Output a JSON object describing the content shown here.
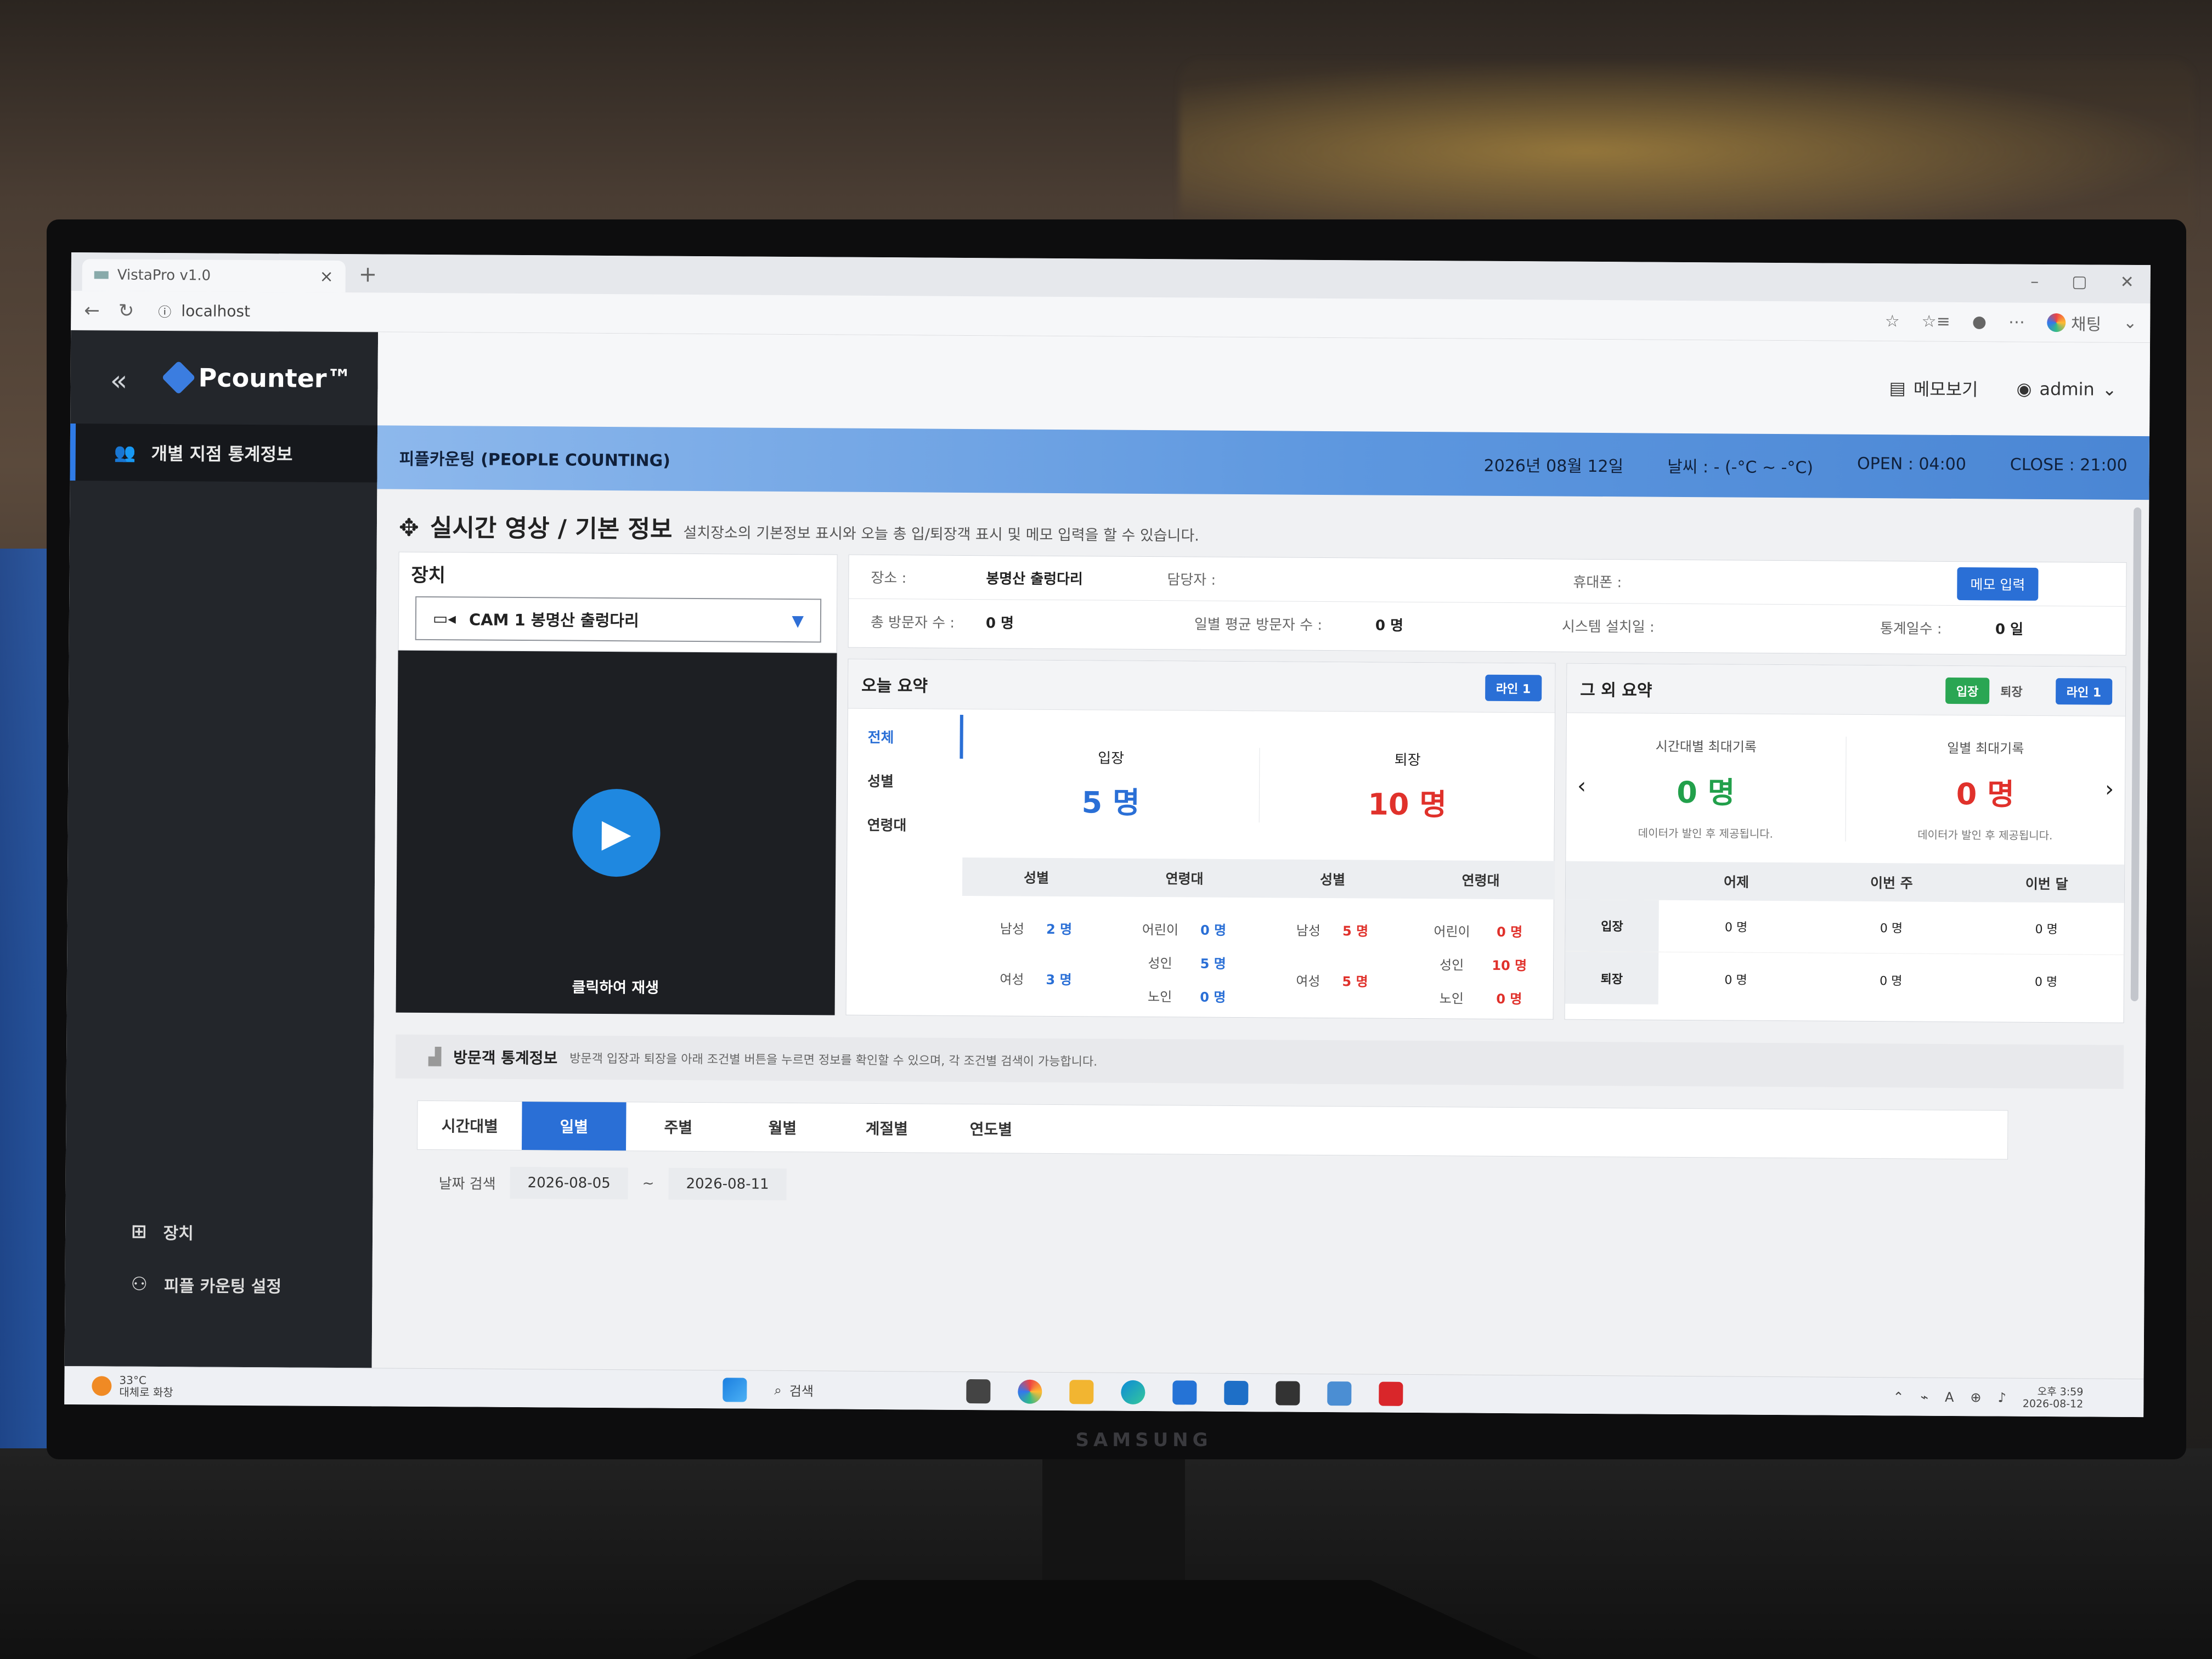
{
  "browser": {
    "tab_title": "VistaPro v1.0",
    "tab_close": "×",
    "new_tab": "+",
    "url": "localhost",
    "right_label": "채팅",
    "win_min": "–",
    "win_max": "▢",
    "win_close": "✕"
  },
  "sidebar": {
    "collapse": "«",
    "logo": "Pcounter™",
    "active_item": "개별 지점 통계정보",
    "items": [
      {
        "label": "장치"
      },
      {
        "label": "피플 카운팅 설정"
      }
    ]
  },
  "topbar": {
    "memo": "메모보기",
    "user": "admin"
  },
  "ribbon": {
    "title": "피플카운팅 (PEOPLE COUNTING)",
    "date": "2026년 08월 12일",
    "weather": "날씨 : - (-°C ~ -°C)",
    "open": "OPEN : 04:00",
    "close": "CLOSE : 21:00"
  },
  "section": {
    "title": "실시간 영상 / 기본 정보",
    "desc": "설치장소의 기본정보 표시와 오늘 총 입/퇴장객 표시 및 메모 입력을 할 수 있습니다."
  },
  "device": {
    "heading": "장치",
    "selected": "CAM 1 봉명산 출렁다리",
    "video_label": "클릭하여 재생"
  },
  "info": {
    "place_k": "장소 :",
    "place_v": "봉명산 출렁다리",
    "manager_k": "담당자 :",
    "phone_k": "휴대폰 :",
    "memo_btn": "메모 입력",
    "total_k": "총 방문자 수 :",
    "total_v": "0 명",
    "avg_k": "일별 평균 방문자 수 :",
    "avg_v": "0 명",
    "install_k": "시스템 설치일 :",
    "days_k": "통계일수 :",
    "days_v": "0 일"
  },
  "today": {
    "heading": "오늘 요약",
    "line_badge": "라인 1",
    "tabs": [
      "전체",
      "성별",
      "연령대"
    ],
    "enter_label": "입장",
    "enter_value": "5 명",
    "exit_label": "퇴장",
    "exit_value": "10 명",
    "sub_headers": [
      "성별",
      "연령대",
      "성별",
      "연령대"
    ],
    "enter_gender": [
      {
        "k": "남성",
        "v": "2 명"
      },
      {
        "k": "여성",
        "v": "3 명"
      }
    ],
    "enter_age": [
      {
        "k": "어린이",
        "v": "0 명"
      },
      {
        "k": "성인",
        "v": "5 명"
      },
      {
        "k": "노인",
        "v": "0 명"
      }
    ],
    "exit_gender": [
      {
        "k": "남성",
        "v": "5 명"
      },
      {
        "k": "여성",
        "v": "5 명"
      }
    ],
    "exit_age": [
      {
        "k": "어린이",
        "v": "0 명"
      },
      {
        "k": "성인",
        "v": "10 명"
      },
      {
        "k": "노인",
        "v": "0 명"
      }
    ]
  },
  "other": {
    "heading": "그 외 요약",
    "badge_enter": "입장",
    "badge_exit": "퇴장",
    "line_badge": "라인 1",
    "hour_max_label": "시간대별 최대기록",
    "hour_max_value": "0 명",
    "day_max_label": "일별 최대기록",
    "day_max_value": "0 명",
    "notice": "데이터가 발인 후 제공됩니다.",
    "prev": "‹",
    "next": "›",
    "cols": [
      "어제",
      "이번 주",
      "이번 달"
    ],
    "rows": [
      {
        "label": "입장",
        "values": [
          "0 명",
          "0 명",
          "0 명"
        ]
      },
      {
        "label": "퇴장",
        "values": [
          "0 명",
          "0 명",
          "0 명"
        ]
      }
    ]
  },
  "stats": {
    "title": "방문객 통계정보",
    "desc": "방문객 입장과 퇴장을 아래 조건별 버튼을 누르면 정보를 확인할 수 있으며, 각 조건별 검색이 가능합니다.",
    "tabs": [
      "시간대별",
      "일별",
      "주별",
      "월별",
      "계절별",
      "연도별"
    ],
    "active_tab": "일별",
    "date_label": "날짜 검색",
    "date_from": "2026-08-05",
    "date_sep": "~",
    "date_to": "2026-08-11"
  },
  "taskbar": {
    "weather_temp": "33°C",
    "weather_desc": "대체로 화창",
    "search": "검색",
    "time": "오후 3:59",
    "date": "2026-08-12"
  },
  "monitor_brand": "SAMSUNG",
  "colors": {
    "accent": "#2a6fd6",
    "enter": "#2a6fd6",
    "exit": "#e0312b",
    "ok": "#22a04b",
    "sidebar": "#23262b"
  }
}
